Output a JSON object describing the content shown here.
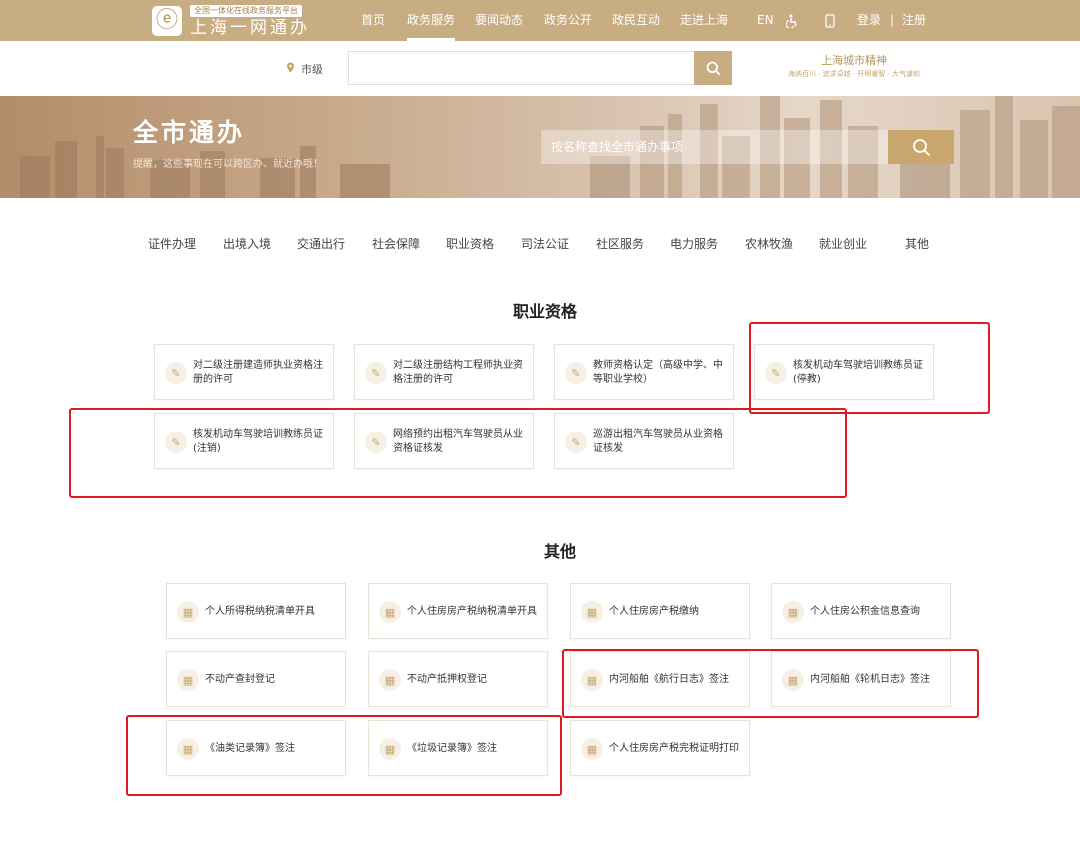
{
  "header": {
    "logo_tag": "全国一体化在线政务服务平台",
    "logo_title": "上海一网通办",
    "nav": [
      "首页",
      "政务服务",
      "要闻动态",
      "政务公开",
      "政民互动",
      "走进上海"
    ],
    "active_nav": "政务服务",
    "lang": "EN",
    "accessibility_icon": "wheelchair-icon",
    "mobile_icon": "mobile-phone-icon",
    "login": "登录",
    "separator": "|",
    "register": "注册"
  },
  "search": {
    "location_icon": "map-pin-icon",
    "location": "市级",
    "placeholder": "",
    "button_icon": "search-icon"
  },
  "brand": {
    "title": "上海城市精神",
    "subtitle": "海纳百川 · 追求卓越 · 开明睿智 · 大气谦和"
  },
  "banner": {
    "title": "全市通办",
    "subtitle": "提醒，这些事现在可以跨区办、就近办哦！",
    "search_placeholder": "按名称查找全市通办事项",
    "button_icon": "search-icon"
  },
  "categories": [
    "证件办理",
    "出境入境",
    "交通出行",
    "社会保障",
    "职业资格",
    "司法公证",
    "社区服务",
    "电力服务",
    "农林牧渔",
    "就业创业",
    "其他"
  ],
  "sections": [
    {
      "title": "职业资格",
      "item_icon": "document-edit-icon",
      "items": [
        "对二级注册建造师执业资格注册的许可",
        "对二级注册结构工程师执业资格注册的许可",
        "教师资格认定（高级中学、中等职业学校）",
        "核发机动车驾驶培训教练员证(停教)",
        "核发机动车驾驶培训教练员证(注销)",
        "网络预约出租汽车驾驶员从业资格证核发",
        "巡游出租汽车驾驶员从业资格证核发"
      ]
    },
    {
      "title": "其他",
      "item_icon": "grid-icon",
      "items": [
        "个人所得税纳税清单开具",
        "个人住房房产税纳税清单开具",
        "个人住房房产税缴纳",
        "个人住房公积金信息查询",
        "不动产查封登记",
        "不动产抵押权登记",
        "内河船舶《航行日志》签注",
        "内河船舶《轮机日志》签注",
        "《油类记录簿》签注",
        "《垃圾记录簿》签注",
        "个人住房房产税完税证明打印"
      ]
    }
  ],
  "colors": {
    "brand_gold": "#c9ad82",
    "accent_gold": "#c9a66e",
    "highlight_red": "#e0191e"
  }
}
